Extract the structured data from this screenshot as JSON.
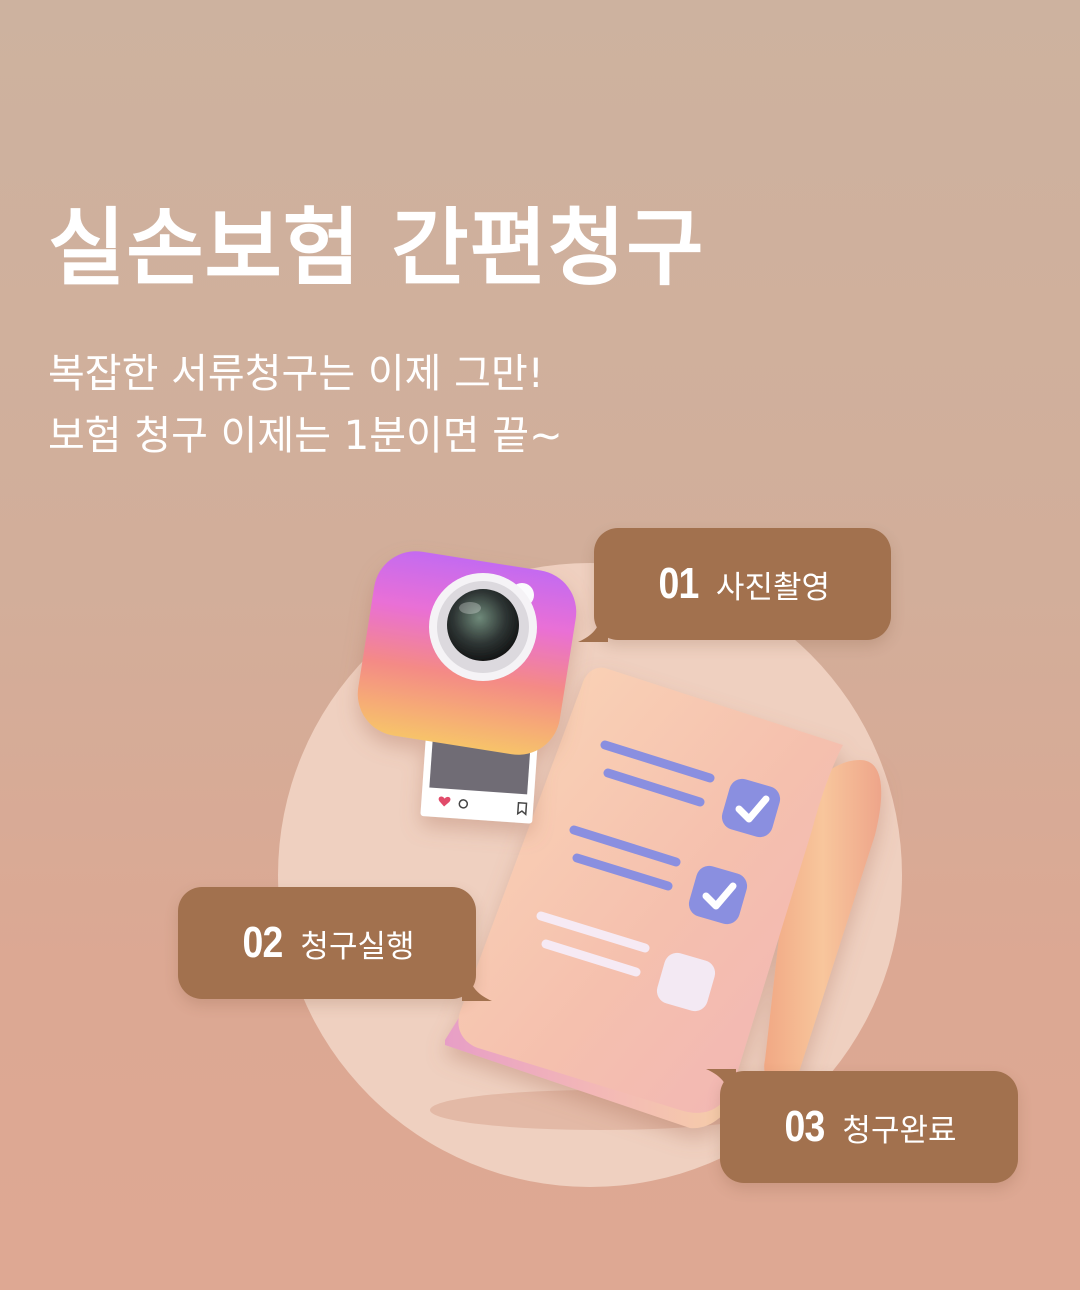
{
  "title": "실손보험 간편청구",
  "subtitle": {
    "line1": "복잡한 서류청구는 이제 그만!",
    "line2": "보험 청구 이제는 1분이면 끝~"
  },
  "steps": [
    {
      "number": "01",
      "label": "사진촬영"
    },
    {
      "number": "02",
      "label": "청구실행"
    },
    {
      "number": "03",
      "label": "청구완료"
    }
  ],
  "colors": {
    "background_top": "#cdb29f",
    "background_bottom": "#dea893",
    "bubble": "#a2714e",
    "circle": "#efd0c0",
    "check_badge": "#8a8fe0",
    "text": "#ffffff"
  },
  "icons": [
    "camera-icon",
    "document-icon",
    "check-icon",
    "heart-icon",
    "comment-icon",
    "bookmark-icon"
  ]
}
